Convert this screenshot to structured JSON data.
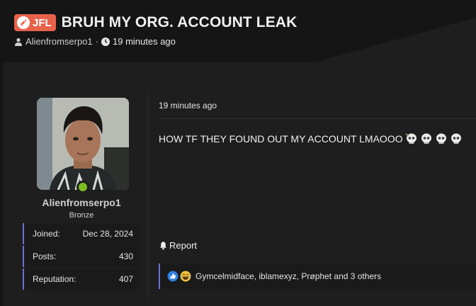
{
  "thread": {
    "prefix": "JFL",
    "title": "BRUH MY ORG. ACCOUNT LEAK",
    "author": "Alienfromserpo1",
    "separator": "·",
    "time": "19 minutes ago",
    "prefix_color": "#e8624b"
  },
  "user": {
    "username": "Alienfromserpo1",
    "title": "Bronze",
    "online_color": "#7bbd1f",
    "stats": [
      {
        "label": "Joined:",
        "value": "Dec 28, 2024"
      },
      {
        "label": "Posts:",
        "value": "430"
      },
      {
        "label": "Reputation:",
        "value": "407"
      }
    ]
  },
  "message": {
    "time": "19 minutes ago",
    "body": "HOW TF THEY FOUND OUT MY ACCOUNT LMAOOO",
    "emojis": [
      "skull-emoji",
      "skull-emoji",
      "skull-emoji",
      "skull-emoji"
    ],
    "report_label": "Report",
    "reactions_text": "Gymcelmidface, iblamexyz, Prøphet and 3 others",
    "reaction_icons": [
      "like-icon",
      "laugh-icon"
    ]
  },
  "colors": {
    "accent": "#6b6fd8",
    "background": "#1e1e1e"
  }
}
